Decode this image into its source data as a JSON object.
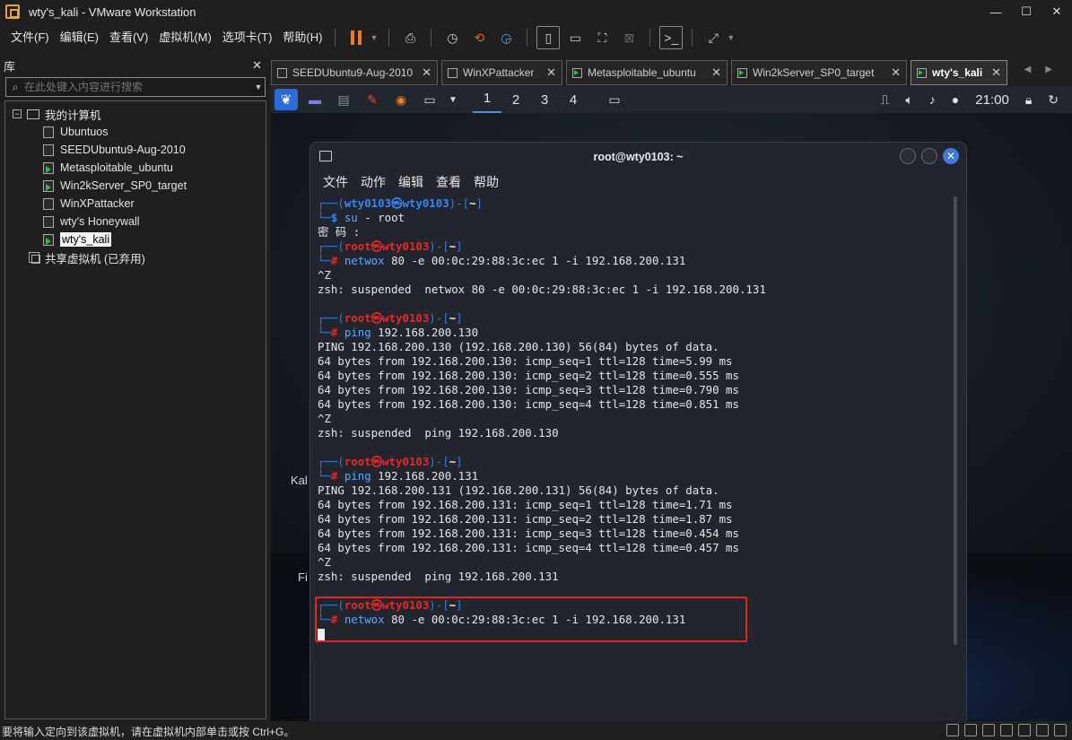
{
  "window": {
    "title": "wty's_kali - VMware Workstation",
    "controls": {
      "minimize": "—",
      "maximize": "☐",
      "close": "✕"
    }
  },
  "menu": [
    "文件(F)",
    "编辑(E)",
    "查看(V)",
    "虚拟机(M)",
    "选项卡(T)",
    "帮助(H)"
  ],
  "library": {
    "title": "库",
    "close": "✕",
    "search_placeholder": "在此处键入内容进行搜索",
    "tree": {
      "root": "我的计算机",
      "vms": [
        {
          "name": "Ubuntuos",
          "running": false,
          "selected": false
        },
        {
          "name": "SEEDUbuntu9-Aug-2010",
          "running": false,
          "selected": false
        },
        {
          "name": "Metasploitable_ubuntu",
          "running": true,
          "selected": false
        },
        {
          "name": "Win2kServer_SP0_target",
          "running": true,
          "selected": false
        },
        {
          "name": "WinXPattacker",
          "running": false,
          "selected": false
        },
        {
          "name": "wty's Honeywall",
          "running": false,
          "selected": false
        },
        {
          "name": "wty's_kali",
          "running": true,
          "selected": true
        }
      ],
      "shared": "共享虚拟机 (已弃用)"
    }
  },
  "tabs": [
    {
      "label": "SEEDUbuntu9-Aug-2010",
      "running": false,
      "active": false
    },
    {
      "label": "WinXPattacker",
      "running": false,
      "active": false
    },
    {
      "label": "Metasploitable_ubuntu",
      "running": true,
      "active": false
    },
    {
      "label": "Win2kServer_SP0_target",
      "running": true,
      "active": false
    },
    {
      "label": "wty's_kali",
      "running": true,
      "active": true
    }
  ],
  "kali_panel": {
    "workspaces": [
      "1",
      "2",
      "3",
      "4"
    ],
    "active_workspace": "1",
    "clock": "21:00"
  },
  "desktop": {
    "labels": [
      "Kal",
      "Fi"
    ]
  },
  "terminal": {
    "title": "root@wty0103: ~",
    "menu": [
      "文件",
      "动作",
      "编辑",
      "查看",
      "帮助"
    ],
    "lines": [
      {
        "t": "prompt-user",
        "user": "wty0103",
        "host": "wty0103",
        "dir": "~"
      },
      {
        "t": "cmd-user",
        "cmd": "su",
        "args": " - root"
      },
      {
        "t": "out",
        "text": "密 码 :"
      },
      {
        "t": "prompt-root",
        "user": "root",
        "host": "wty0103",
        "dir": "~"
      },
      {
        "t": "cmd-root",
        "cmd": "netwox",
        "args": " 80 -e 00:0c:29:88:3c:ec 1 -i 192.168.200.131"
      },
      {
        "t": "out",
        "text": "^Z"
      },
      {
        "t": "out",
        "text": "zsh: suspended  netwox 80 -e 00:0c:29:88:3c:ec 1 -i 192.168.200.131"
      },
      {
        "t": "out",
        "text": ""
      },
      {
        "t": "prompt-root",
        "user": "root",
        "host": "wty0103",
        "dir": "~"
      },
      {
        "t": "cmd-root",
        "cmd": "ping",
        "args": " 192.168.200.130"
      },
      {
        "t": "out",
        "text": "PING 192.168.200.130 (192.168.200.130) 56(84) bytes of data."
      },
      {
        "t": "out",
        "text": "64 bytes from 192.168.200.130: icmp_seq=1 ttl=128 time=5.99 ms"
      },
      {
        "t": "out",
        "text": "64 bytes from 192.168.200.130: icmp_seq=2 ttl=128 time=0.555 ms"
      },
      {
        "t": "out",
        "text": "64 bytes from 192.168.200.130: icmp_seq=3 ttl=128 time=0.790 ms"
      },
      {
        "t": "out",
        "text": "64 bytes from 192.168.200.130: icmp_seq=4 ttl=128 time=0.851 ms"
      },
      {
        "t": "out",
        "text": "^Z"
      },
      {
        "t": "out",
        "text": "zsh: suspended  ping 192.168.200.130"
      },
      {
        "t": "out",
        "text": ""
      },
      {
        "t": "prompt-root",
        "user": "root",
        "host": "wty0103",
        "dir": "~"
      },
      {
        "t": "cmd-root",
        "cmd": "ping",
        "args": " 192.168.200.131"
      },
      {
        "t": "out",
        "text": "PING 192.168.200.131 (192.168.200.131) 56(84) bytes of data."
      },
      {
        "t": "out",
        "text": "64 bytes from 192.168.200.131: icmp_seq=1 ttl=128 time=1.71 ms"
      },
      {
        "t": "out",
        "text": "64 bytes from 192.168.200.131: icmp_seq=2 ttl=128 time=1.87 ms"
      },
      {
        "t": "out",
        "text": "64 bytes from 192.168.200.131: icmp_seq=3 ttl=128 time=0.454 ms"
      },
      {
        "t": "out",
        "text": "64 bytes from 192.168.200.131: icmp_seq=4 ttl=128 time=0.457 ms"
      },
      {
        "t": "out",
        "text": "^Z"
      },
      {
        "t": "out",
        "text": "zsh: suspended  ping 192.168.200.131"
      },
      {
        "t": "out",
        "text": ""
      },
      {
        "t": "prompt-root",
        "user": "root",
        "host": "wty0103",
        "dir": "~"
      },
      {
        "t": "cmd-root",
        "cmd": "netwox",
        "args": " 80 -e 00:0c:29:88:3c:ec 1 -i 192.168.200.131"
      },
      {
        "t": "cursor"
      }
    ]
  },
  "status": {
    "message": "要将输入定向到该虚拟机，请在虚拟机内部单击或按 Ctrl+G。"
  },
  "colors": {
    "accent": "#2b6bd6",
    "prompt_user": "#3a86f0",
    "prompt_root": "#e02b2b",
    "highlight": "#e02424",
    "running": "#3bb44a"
  }
}
